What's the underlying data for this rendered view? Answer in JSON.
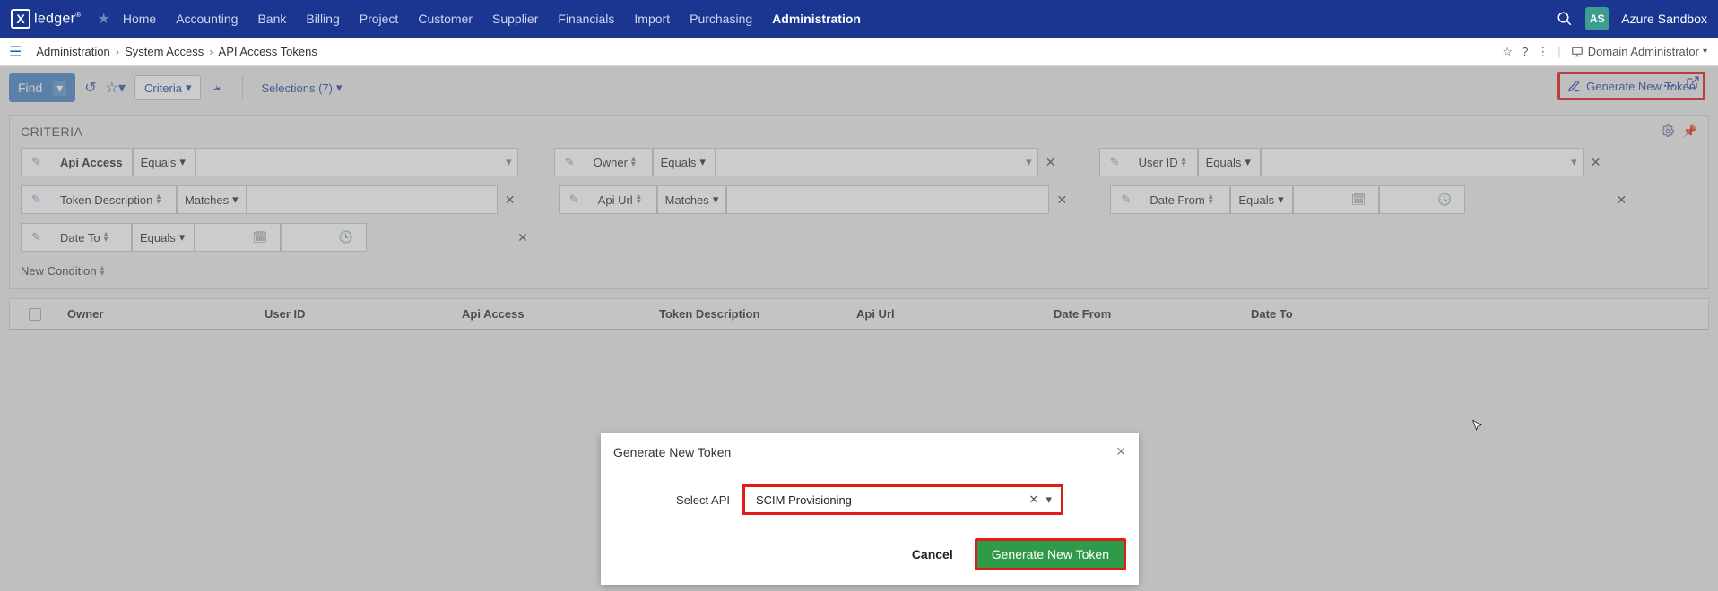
{
  "nav": {
    "logo_letter": "X",
    "logo_text": "ledger",
    "items": [
      "Home",
      "Accounting",
      "Bank",
      "Billing",
      "Project",
      "Customer",
      "Supplier",
      "Financials",
      "Import",
      "Purchasing",
      "Administration"
    ],
    "active_index": 10
  },
  "profile": {
    "initials": "AS",
    "name": "Azure Sandbox"
  },
  "breadcrumb": {
    "items": [
      "Administration",
      "System Access",
      "API Access Tokens"
    ],
    "role_label": "Domain Administrator"
  },
  "toolbar": {
    "find_label": "Find",
    "criteria_label": "Criteria",
    "selections_label": "Selections (7)",
    "generate_label": "Generate New Token"
  },
  "criteria": {
    "title": "CRITERIA",
    "new_condition": "New Condition",
    "fields": {
      "api_access": {
        "label": "Api Access",
        "op": "Equals"
      },
      "owner": {
        "label": "Owner",
        "op": "Equals"
      },
      "user_id": {
        "label": "User ID",
        "op": "Equals"
      },
      "token_desc": {
        "label": "Token Description",
        "op": "Matches"
      },
      "api_url": {
        "label": "Api Url",
        "op": "Matches"
      },
      "date_from": {
        "label": "Date From",
        "op": "Equals"
      },
      "date_to": {
        "label": "Date To",
        "op": "Equals"
      }
    }
  },
  "table": {
    "columns": [
      "Owner",
      "User ID",
      "Api Access",
      "Token Description",
      "Api Url",
      "Date From",
      "Date To"
    ]
  },
  "modal": {
    "title": "Generate New Token",
    "select_label": "Select API",
    "select_value": "SCIM Provisioning",
    "cancel": "Cancel",
    "generate": "Generate New Token"
  }
}
